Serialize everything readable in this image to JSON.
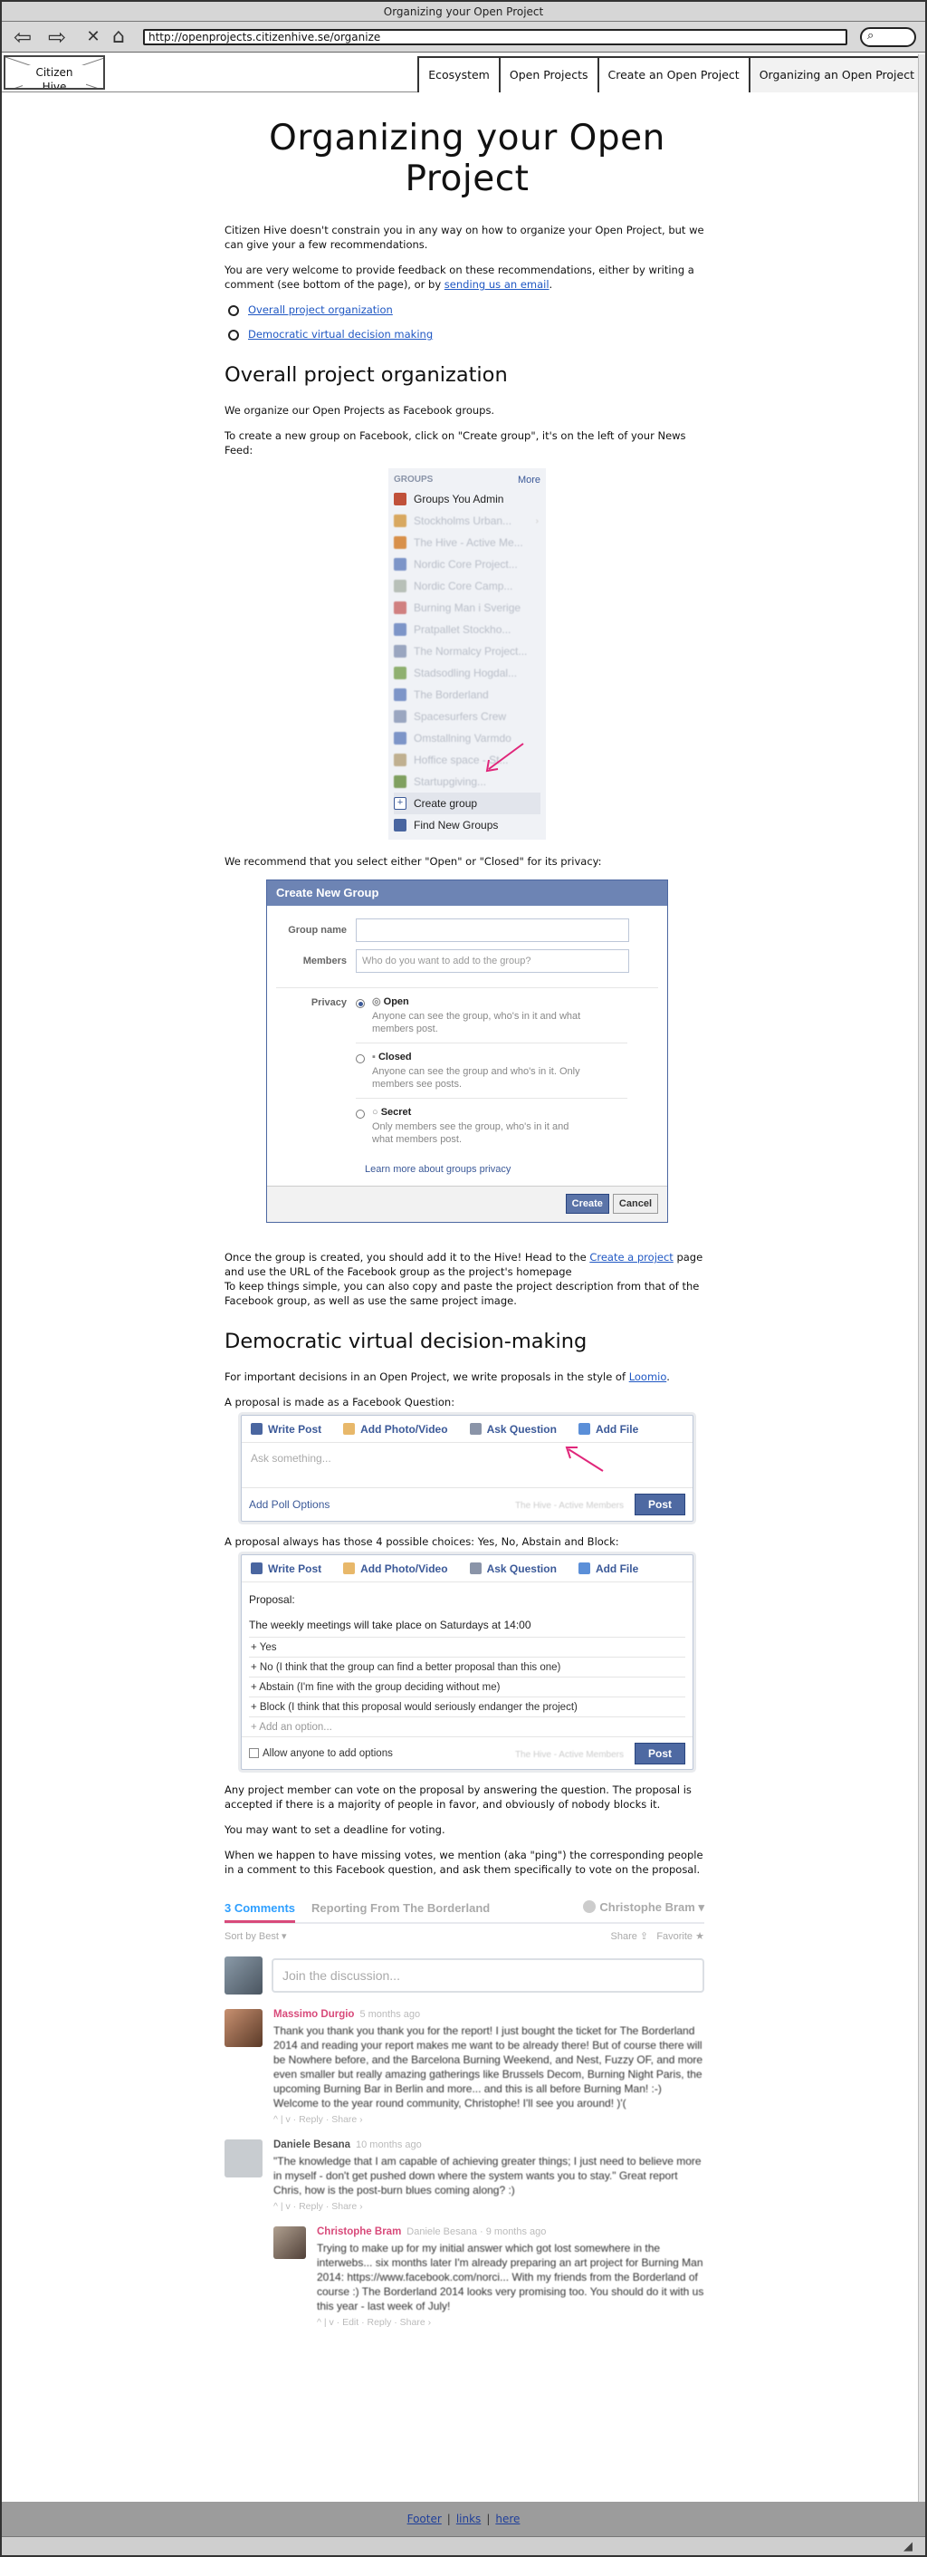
{
  "window": {
    "title": "Organizing your Open Project"
  },
  "browser": {
    "url": "http://openprojects.citizenhive.se/organize"
  },
  "header": {
    "logo": "Citizen Hive",
    "nav": [
      "Ecosystem",
      "Open Projects",
      "Create an Open Project",
      "Organizing an Open Project"
    ]
  },
  "page": {
    "title": "Organizing your Open Project",
    "intro1": "Citizen Hive doesn't constrain you in any way on how to organize your Open Project, but we can give your a few recommendations.",
    "intro2_pre": "You are very welcome to provide feedback on these recommendations, either by writing a comment (see bottom of the page), or by ",
    "intro2_link": "sending us an email",
    "intro2_post": ".",
    "toc": [
      "Overall project organization",
      "Democratic virtual decision making"
    ],
    "section1_title": "Overall project organization",
    "s1_p1": "We organize our Open Projects as Facebook groups.",
    "s1_p2": "To create a new group on Facebook, click on \"Create group\", it's on the left of your News Feed:",
    "s1_p3": "We recommend that you select either \"Open\" or \"Closed\" for its privacy:",
    "s1_p4_pre": "Once the group is created, you should add it to the Hive! Head to the ",
    "s1_p4_link": "Create a project",
    "s1_p4_post": " page and use the URL of the Facebook group as the project's homepage",
    "s1_p5": "To keep things simple, you can also copy and paste the project description from that of the Facebook group, as well as use the same project image.",
    "section2_title": "Democratic virtual decision-making",
    "s2_p1_pre": "For important decisions in an Open Project, we write proposals in the style of ",
    "s2_p1_link": "Loomio",
    "s2_p1_post": ".",
    "s2_p2": "A proposal is made as a Facebook Question:",
    "s2_p3": "A proposal always has those 4 possible choices: Yes, No, Abstain and Block:",
    "s2_p4": "Any project member can vote on the proposal by answering the question. The proposal is accepted if there is a majority of people in favor, and obviously of nobody blocks it.",
    "s2_p5": "You may want to set a deadline for voting.",
    "s2_p6": "When we happen to have missing votes, we mention (aka \"ping\") the corresponding people in a comment to this Facebook question, and ask them specifically to vote on the proposal."
  },
  "groups_widget": {
    "header": "GROUPS",
    "more": "More",
    "items": [
      "Groups You Admin",
      "Stockholms Urban...",
      "The Hive - Active Me...",
      "Nordic Core Project...",
      "Nordic Core Camp...",
      "Burning Man i Sverige",
      "Pratpallet Stockho...",
      "The Normalcy Project...",
      "Stadsodling Hogdal...",
      "The Borderland",
      "Spacesurfers Crew",
      "Omstallning Varmdo",
      "Hoffice space - St...",
      "Startupgiving..."
    ],
    "create": "Create group",
    "find": "Find New Groups"
  },
  "create_group_dialog": {
    "title": "Create New Group",
    "group_name_label": "Group name",
    "members_label": "Members",
    "members_placeholder": "Who do you want to add to the group?",
    "privacy_label": "Privacy",
    "options": [
      {
        "name": "Open",
        "desc": "Anyone can see the group, who's in it and what members post."
      },
      {
        "name": "Closed",
        "desc": "Anyone can see the group and who's in it. Only members see posts."
      },
      {
        "name": "Secret",
        "desc": "Only members see the group, who's in it and what members post."
      }
    ],
    "learn_more": "Learn more about groups privacy",
    "create_btn": "Create",
    "cancel_btn": "Cancel"
  },
  "composer1": {
    "tabs": [
      "Write Post",
      "Add Photo/Video",
      "Ask Question",
      "Add File"
    ],
    "placeholder": "Ask something...",
    "poll_options": "Add Poll Options",
    "group": "The Hive - Active Members",
    "post": "Post"
  },
  "composer2": {
    "tabs": [
      "Write Post",
      "Add Photo/Video",
      "Ask Question",
      "Add File"
    ],
    "proposal_label": "Proposal:",
    "question": "The weekly meetings will take place on Saturdays at 14:00",
    "options": [
      "Yes",
      "No (I think that the group can find a better proposal than this one)",
      "Abstain (I'm fine with the group deciding without me)",
      "Block (I think that this proposal would seriously endanger the project)",
      "Add an option..."
    ],
    "allow": "Allow anyone to add options",
    "group": "The Hive - Active Members",
    "post": "Post"
  },
  "comments": {
    "count": "3 Comments",
    "tab2": "Reporting From The Borderland",
    "user": "Christophe Bram",
    "sort": "Sort by Best",
    "share": "Share",
    "favorite": "Favorite",
    "join_placeholder": "Join the discussion...",
    "items": [
      {
        "author": "Massimo Durgio",
        "time": "5 months ago",
        "text": "Thank you thank you thank you for the report! I just bought the ticket for The Borderland 2014 and reading your report makes me want to be already there! But of course there will be Nowhere before, and the Barcelona Burning Weekend, and Nest, Fuzzy OF, and more even smaller but really amazing gatherings like Brussels Decom, Burning Night Paris, the upcoming Burning Bar in Berlin and more... and this is all before Burning Man! :-) Welcome to the year round community, Christophe! I'll see you around! )'(",
        "actions": "^ | v  ·  Reply  ·  Share ›"
      },
      {
        "author": "Daniele Besana",
        "time": "10 months ago",
        "text": "\"The knowledge that I am capable of achieving greater things; I just need to believe more in myself - don't get pushed down where the system wants you to stay.\" Great report Chris, how is the post-burn blues coming along? :)",
        "actions": "^ | v  ·  Reply  ·  Share ›"
      },
      {
        "author": "Christophe Bram",
        "time": "Daniele Besana  ·  9 months ago",
        "text": "Trying to make up for my initial answer which got lost somewhere in the interwebs... six months later I'm already preparing an art project for Burning Man 2014: https://www.facebook.com/norci... With my friends from the Borderland of course :) The Borderland 2014 looks very promising too. You should do it with us this year - last week of July!",
        "actions": "^ | v  ·  Edit  ·  Reply  ·  Share ›"
      }
    ]
  },
  "footer": {
    "links": [
      "Footer",
      "links",
      "here"
    ]
  },
  "colors": {
    "link": "#1f57c3",
    "fb_blue": "#3b5998",
    "dialog_header": "#6d84b4",
    "disqus_pink": "#d84a7a",
    "arrow": "#e0267a"
  }
}
